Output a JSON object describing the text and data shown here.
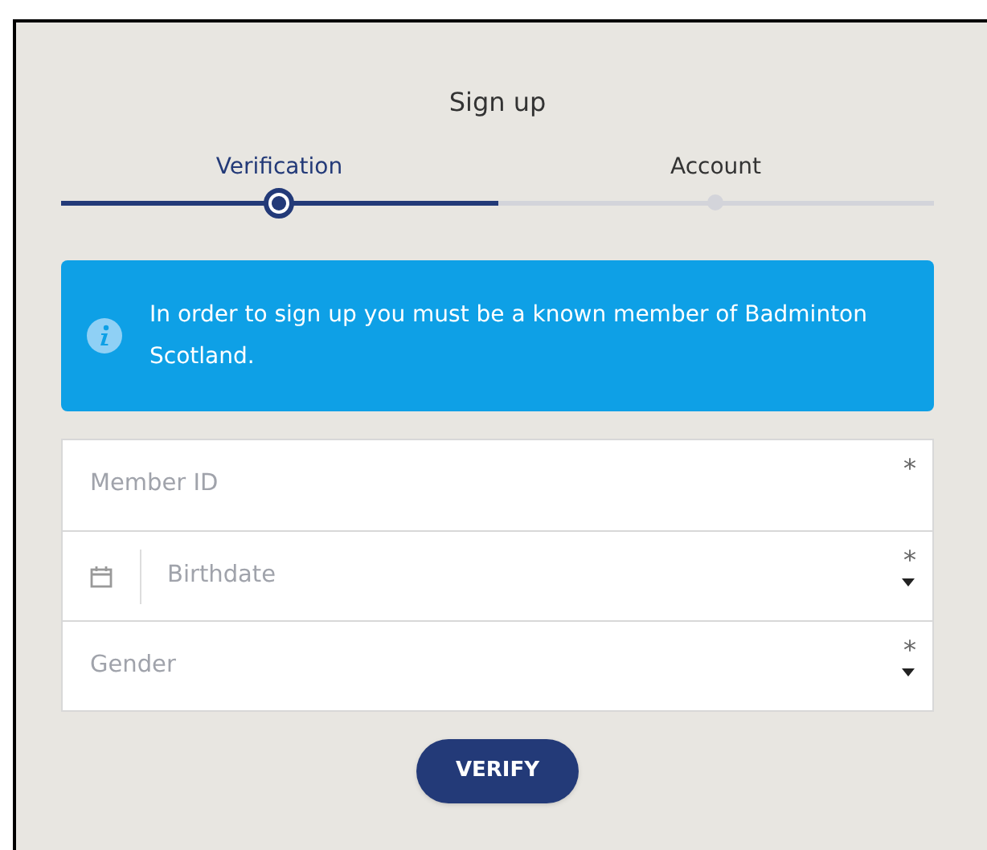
{
  "title": "Sign up",
  "steps": [
    {
      "label": "Verification",
      "selected": true
    },
    {
      "label": "Account",
      "selected": false
    }
  ],
  "info": {
    "text": "In order to sign up you must be a known member of Badminton Scotland."
  },
  "fields": [
    {
      "kind": "text",
      "placeholder": "Member ID",
      "required": "*"
    },
    {
      "kind": "date",
      "placeholder": "Birthdate",
      "required": "*"
    },
    {
      "kind": "select",
      "placeholder": "Gender",
      "required": "*"
    }
  ],
  "button": "VERIFY"
}
